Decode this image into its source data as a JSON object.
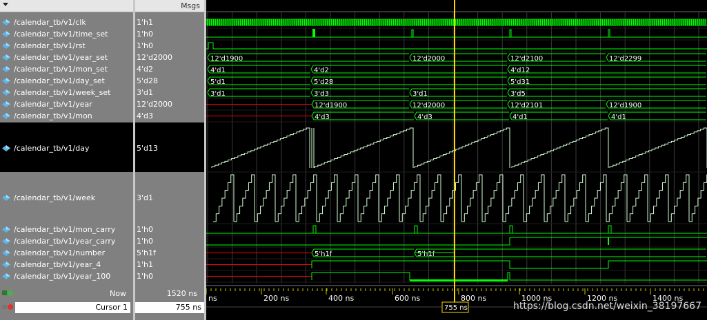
{
  "header": {
    "msgs": "Msgs"
  },
  "signals": [
    {
      "name": "/calendar_tb/v1/clk",
      "value": "1'h1"
    },
    {
      "name": "/calendar_tb/v1/time_set",
      "value": "1'h0"
    },
    {
      "name": "/calendar_tb/v1/rst",
      "value": "1'h0"
    },
    {
      "name": "/calendar_tb/v1/year_set",
      "value": "12'd2000"
    },
    {
      "name": "/calendar_tb/v1/mon_set",
      "value": "4'd2"
    },
    {
      "name": "/calendar_tb/v1/day_set",
      "value": "5'd28"
    },
    {
      "name": "/calendar_tb/v1/week_set",
      "value": "3'd1"
    },
    {
      "name": "/calendar_tb/v1/year",
      "value": "12'd2000"
    },
    {
      "name": "/calendar_tb/v1/mon",
      "value": "4'd3"
    },
    {
      "name": "/calendar_tb/v1/day",
      "value": "5'd13"
    },
    {
      "name": "/calendar_tb/v1/week",
      "value": "3'd1"
    },
    {
      "name": "/calendar_tb/v1/mon_carry",
      "value": "1'h0"
    },
    {
      "name": "/calendar_tb/v1/year_carry",
      "value": "1'h0"
    },
    {
      "name": "/calendar_tb/v1/number",
      "value": "5'h1f"
    },
    {
      "name": "/calendar_tb/v1/year_4",
      "value": "1'h1"
    },
    {
      "name": "/calendar_tb/v1/year_100",
      "value": "1'h0"
    }
  ],
  "bus_labels": {
    "year_set": [
      "12'd1900",
      "12'd2000",
      "12'd2100",
      "12'd2299"
    ],
    "mon_set": [
      "4'd1",
      "4'd2",
      "4'd12"
    ],
    "day_set": [
      "5'd1",
      "5'd28",
      "5'd31"
    ],
    "week_set": [
      "3'd1",
      "3'd3",
      "3'd1",
      "3'd5"
    ],
    "year": [
      "12'd1900",
      "12'd2000",
      "12'd2101",
      "12'd1900"
    ],
    "mon": [
      "4'd3",
      "4'd3",
      "4'd1",
      "4'd1"
    ],
    "number": [
      "5'h1f",
      "5'h1f"
    ]
  },
  "footer": {
    "now_label": "Now",
    "now_value": "1520 ns",
    "cursor_label": "Cursor 1",
    "cursor_value": "755 ns",
    "cursor_tag": "755 ns"
  },
  "timeline": {
    "ticks": [
      "ns",
      "200 ns",
      "400 ns",
      "600 ns",
      "800 ns",
      "1000 ns",
      "1200 ns",
      "1400 ns"
    ]
  },
  "watermark": "https://blog.csdn.net/weixin_38197667",
  "colors": {
    "wave": "#00ff00",
    "wave_analog": "#d6ffd6",
    "undefined": "#ff0000",
    "cursor": "#ffd800",
    "grid": "#3a3a3a"
  }
}
